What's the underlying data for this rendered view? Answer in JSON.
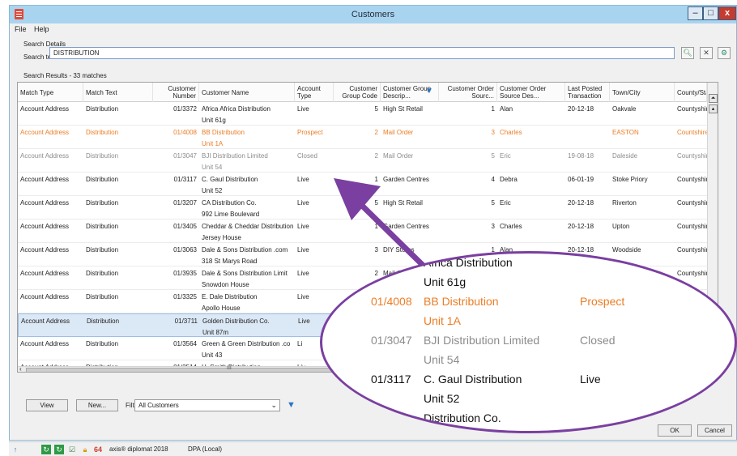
{
  "window": {
    "title": "Customers",
    "controls": {
      "minimize": "–",
      "maximize": "□",
      "close": "x"
    }
  },
  "menu": [
    "File",
    "Help"
  ],
  "search": {
    "section_label": "Search Details",
    "field_label": "Search text",
    "value": "DISTRIBUTION",
    "results_label": "Search Results - 33 matches"
  },
  "grid": {
    "columns": [
      "Match Type",
      "Match Text",
      "Customer Number",
      "Customer Name",
      "Account Type",
      "Customer Group Code",
      "Customer Group Descrip...",
      "Customer Order Sourc...",
      "Customer Order Source Des...",
      "Last Posted Transaction",
      "Town/City",
      "County/State"
    ],
    "rows": [
      {
        "match_type": "Account Address",
        "match_text": "Distribution",
        "number": "01/3372",
        "name": "Africa Africa Distribution",
        "name2": "Unit 61g",
        "account_type": "Live",
        "group_code": "5",
        "group_desc": "High St Retail",
        "order_source": "1",
        "order_source_desc": "Alan",
        "last_posted": "20-12-18",
        "town": "Oakvale",
        "county": "Countyshire",
        "style": "normal"
      },
      {
        "match_type": "Account Address",
        "match_text": "Distribution",
        "number": "01/4008",
        "name": "BB Distribution",
        "name2": "Unit 1A",
        "account_type": "Prospect",
        "group_code": "2",
        "group_desc": "Mail Order",
        "order_source": "3",
        "order_source_desc": "Charles",
        "last_posted": "",
        "town": "EASTON",
        "county": "Countshire",
        "style": "orange"
      },
      {
        "match_type": "Account Address",
        "match_text": "Distribution",
        "number": "01/3047",
        "name": "BJI Distribution Limited",
        "name2": "Unit 54",
        "account_type": "Closed",
        "group_code": "2",
        "group_desc": "Mail Order",
        "order_source": "5",
        "order_source_desc": "Eric",
        "last_posted": "19-08-18",
        "town": "Daleside",
        "county": "Countyshire",
        "style": "grey"
      },
      {
        "match_type": "Account Address",
        "match_text": "Distribution",
        "number": "01/3117",
        "name": "C. Gaul Distribution",
        "name2": "Unit 52",
        "account_type": "Live",
        "group_code": "1",
        "group_desc": "Garden Centres",
        "order_source": "4",
        "order_source_desc": "Debra",
        "last_posted": "06-01-19",
        "town": "Stoke Priory",
        "county": "Countyshire",
        "style": "normal"
      },
      {
        "match_type": "Account Address",
        "match_text": "Distribution",
        "number": "01/3207",
        "name": "CA Distribution Co.",
        "name2": "992 Lime Boulevard",
        "account_type": "Live",
        "group_code": "5",
        "group_desc": "High St Retail",
        "order_source": "5",
        "order_source_desc": "Eric",
        "last_posted": "20-12-18",
        "town": "Riverton",
        "county": "Countyshire",
        "style": "normal"
      },
      {
        "match_type": "Account Address",
        "match_text": "Distribution",
        "number": "01/3405",
        "name": "Cheddar & Cheddar Distribution",
        "name2": "Jersey House",
        "account_type": "Live",
        "group_code": "1",
        "group_desc": "Garden Centres",
        "order_source": "3",
        "order_source_desc": "Charles",
        "last_posted": "20-12-18",
        "town": "Upton",
        "county": "Countyshire",
        "style": "normal"
      },
      {
        "match_type": "Account Address",
        "match_text": "Distribution",
        "number": "01/3063",
        "name": "Dale & Sons Distribution .com",
        "name2": "318 St Marys Road",
        "account_type": "Live",
        "group_code": "3",
        "group_desc": "DIY Stores",
        "order_source": "1",
        "order_source_desc": "Alan",
        "last_posted": "20-12-18",
        "town": "Woodside",
        "county": "Countyshire",
        "style": "normal"
      },
      {
        "match_type": "Account Address",
        "match_text": "Distribution",
        "number": "01/3935",
        "name": "Dale & Sons Distribution Limit",
        "name2": "Snowdon House",
        "account_type": "Live",
        "group_code": "2",
        "group_desc": "Mail Order",
        "order_source": "",
        "order_source_desc": "",
        "last_posted": "20-12-18",
        "town": "Woodside",
        "county": "Countyshire",
        "style": "normal"
      },
      {
        "match_type": "Account Address",
        "match_text": "Distribution",
        "number": "01/3325",
        "name": "E. Dale Distribution",
        "name2": "Apollo House",
        "account_type": "Live",
        "group_code": "",
        "group_desc": "",
        "order_source": "",
        "order_source_desc": "",
        "last_posted": "",
        "town": "",
        "county": "Countyshire",
        "style": "normal"
      },
      {
        "match_type": "Account Address",
        "match_text": "Distribution",
        "number": "01/3711",
        "name": "Golden Distribution Co.",
        "name2": "Unit 87m",
        "account_type": "Live",
        "group_code": "",
        "group_desc": "",
        "order_source": "",
        "order_source_desc": "",
        "last_posted": "",
        "town": "",
        "county": "Countyshire",
        "style": "selected"
      },
      {
        "match_type": "Account Address",
        "match_text": "Distribution",
        "number": "01/3564",
        "name": "Green & Green Distribution .co",
        "name2": "Unit 43",
        "account_type": "Li",
        "group_code": "",
        "group_desc": "",
        "order_source": "",
        "order_source_desc": "",
        "last_posted": "",
        "town": "",
        "county": "ntyshire",
        "style": "normal"
      },
      {
        "match_type": "Account Address",
        "match_text": "Distribution",
        "number": "01/3514",
        "name": "H. Smith Distribution",
        "name2": "",
        "account_type": "Liv",
        "group_code": "",
        "group_desc": "",
        "order_source": "",
        "order_source_desc": "",
        "last_posted": "",
        "town": "",
        "county": "ntyshire",
        "style": "normal"
      }
    ]
  },
  "footer": {
    "view_label": "View",
    "new_label": "New...",
    "filter_label": "Filter",
    "filter_value": "All Customers",
    "ok_label": "OK",
    "cancel_label": "Cancel"
  },
  "statusbar": {
    "product": "axis® diplomat 2018",
    "db": "DPA (Local)"
  },
  "magnifier": {
    "rows": [
      {
        "number": "",
        "name": "Africa Distribution",
        "type": "",
        "style": "dark"
      },
      {
        "number": "",
        "name": "Unit 61g",
        "type": "",
        "style": "dark"
      },
      {
        "number": "01/4008",
        "name": "BB Distribution",
        "type": "Prospect",
        "style": "orange"
      },
      {
        "number": "",
        "name": "Unit 1A",
        "type": "",
        "style": "orange"
      },
      {
        "number": "01/3047",
        "name": "BJI Distribution Limited",
        "type": "Closed",
        "style": "grey"
      },
      {
        "number": "",
        "name": "Unit 54",
        "type": "",
        "style": "grey"
      },
      {
        "number": "01/3117",
        "name": "C. Gaul Distribution",
        "type": "Live",
        "style": "dark"
      },
      {
        "number": "",
        "name": "Unit 52",
        "type": "",
        "style": "dark"
      },
      {
        "number": "",
        "name": "Distribution Co.",
        "type": "",
        "style": "dark"
      }
    ]
  },
  "colors": {
    "accent": "#7a3fa0",
    "prospect": "#ec7d25",
    "closed": "#8c8c8c",
    "selection": "#dbe8f6",
    "titlebar": "#a9d4f0"
  }
}
